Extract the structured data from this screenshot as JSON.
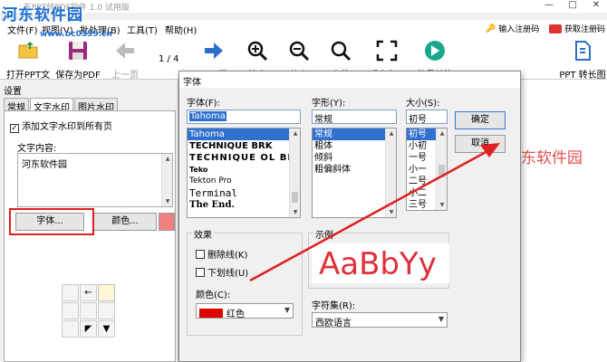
{
  "app": {
    "title": "东PPT转PDF软件 1.0 试用版",
    "watermark": "河东软件园",
    "watermark_url": "www.pc0359.cn"
  },
  "window_controls": {
    "minimize": "—",
    "maximize": "□",
    "close": "✕"
  },
  "menu": {
    "items": [
      "文件(F)",
      "视图(V)",
      "批处理(B)",
      "工具(T)",
      "帮助(H)"
    ],
    "register": "输入注册码",
    "buy": "获取注册码"
  },
  "toolbar": {
    "open": "打开PPT文件",
    "save": "保存为PDF",
    "prev": "上一页",
    "page": "1 / 4",
    "next": "下一页",
    "zoom_in": "放大",
    "zoom_out": "缩小",
    "find": "查找",
    "fit": "适合窗口",
    "batch": "批量转换",
    "ppt_to": "PPT 转长图"
  },
  "settings": {
    "title": "设置",
    "tabs": [
      "常规",
      "文字水印",
      "图片水印"
    ],
    "add_watermark_all": "添加文字水印到所有页",
    "text_content_label": "文字内容:",
    "text_content_value": "河东软件园",
    "font_button": "字体...",
    "color_button": "颜色...",
    "color_value": "#f08080",
    "position_grid": [
      "",
      "←",
      "",
      "",
      "",
      "",
      "",
      "",
      ""
    ]
  },
  "preview": {
    "text": "东软件园"
  },
  "font_dialog": {
    "title": "字体",
    "font_label": "字体(F):",
    "font_value": "Tahoma",
    "font_list": [
      "Tahoma",
      "TECHNIQUE BRK",
      "TECHNIQUE OL BRK",
      "Teko",
      "Tekton Pro",
      "Terminal",
      "The End."
    ],
    "style_label": "字形(Y):",
    "style_value": "常规",
    "style_list": [
      "常规",
      "粗体",
      "倾斜",
      "粗偏斜体"
    ],
    "size_label": "大小(S):",
    "size_value": "初号",
    "size_list": [
      "初号",
      "小初",
      "一号",
      "小一",
      "二号",
      "小二",
      "三号"
    ],
    "ok": "确定",
    "cancel": "取消",
    "effects_label": "效果",
    "strikeout": "删除线(K)",
    "underline": "下划线(U)",
    "color_label": "颜色(C):",
    "color_value": "红色",
    "sample_label": "示例",
    "sample_text": "AaBbYy",
    "charset_label": "字符集(R):",
    "charset_value": "西欧语言"
  }
}
